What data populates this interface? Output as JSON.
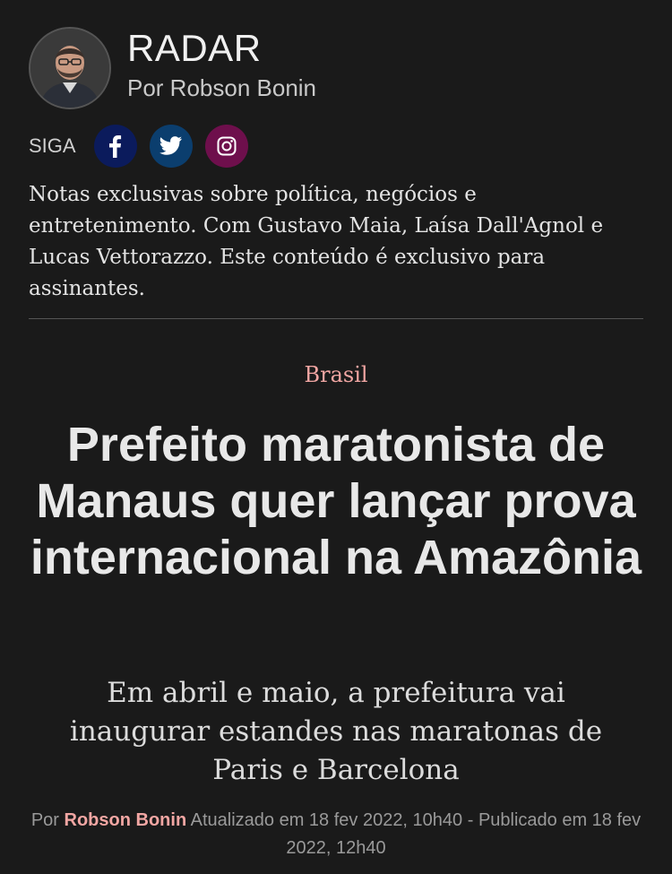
{
  "column": {
    "title": "RADAR",
    "byline": "Por Robson Bonin"
  },
  "follow": {
    "label": "SIGA",
    "networks": [
      {
        "name": "facebook",
        "icon": "facebook-icon",
        "color": "#0b1b5c"
      },
      {
        "name": "twitter",
        "icon": "twitter-icon",
        "color": "#0b3e6e"
      },
      {
        "name": "instagram",
        "icon": "instagram-icon",
        "color": "#6e0f4c"
      }
    ]
  },
  "description": "Notas exclusivas sobre política, negócios e entretenimento. Com Gustavo Maia, Laísa Dall'Agnol e Lucas Vettorazzo. Este conteúdo é exclusivo para assinantes.",
  "article": {
    "category": "Brasil",
    "headline": "Prefeito maratonista de Manaus quer lançar prova internacional na Amazônia",
    "subtitle": "Em abril e maio, a prefeitura vai inaugurar estandes nas maratonas de Paris e Barcelona",
    "meta": {
      "by_prefix": "Por",
      "author": "Robson Bonin",
      "dates": "Atualizado em 18 fev 2022, 10h40 - Publicado em 18 fev 2022, 12h40"
    }
  },
  "colors": {
    "background": "#1a1a1a",
    "accent": "#f2a6a3"
  }
}
